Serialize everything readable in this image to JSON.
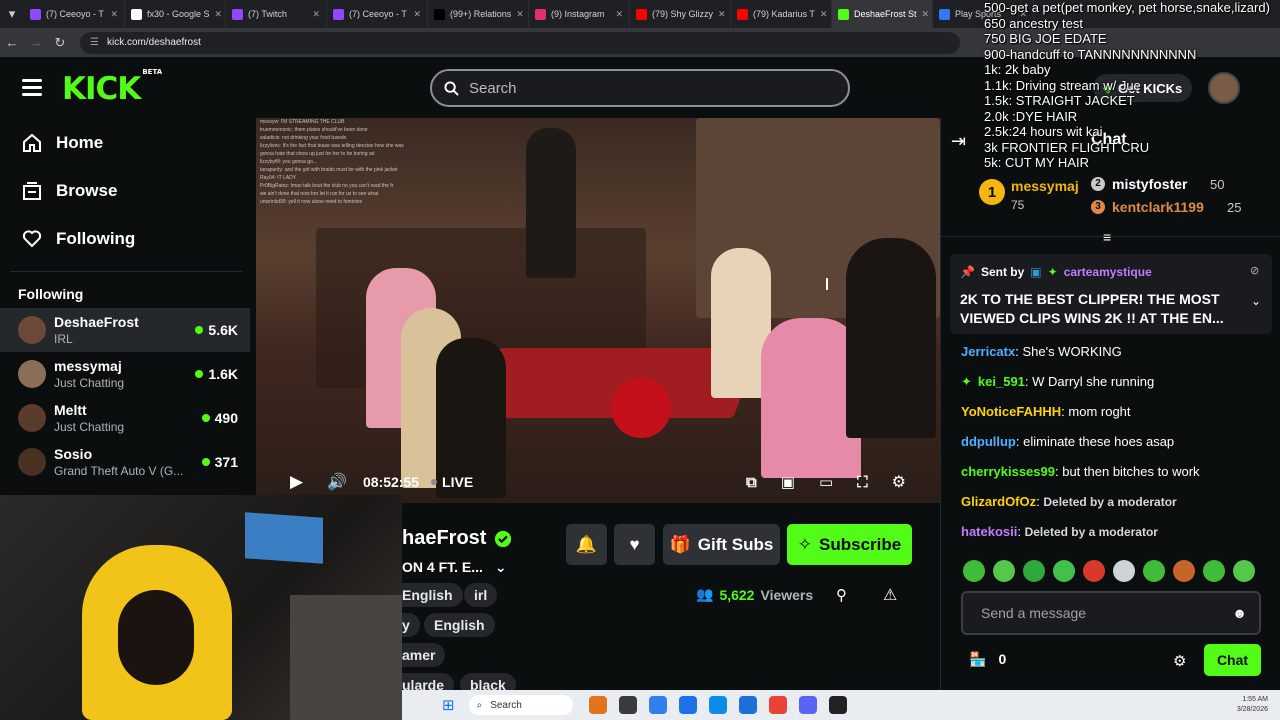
{
  "browser": {
    "tabs": [
      {
        "label": "(7) Ceeoyo - T",
        "color": "#9146ff"
      },
      {
        "label": "fx30 - Google S",
        "color": "#ffffff"
      },
      {
        "label": "(7) Twitch",
        "color": "#9146ff"
      },
      {
        "label": "(7) Ceeoyo - T",
        "color": "#9146ff"
      },
      {
        "label": "(99+) Relations",
        "color": "#000000"
      },
      {
        "label": "(9) Instagram",
        "color": "#e1306c"
      },
      {
        "label": "(79) Shy Glizzy",
        "color": "#ff0000"
      },
      {
        "label": "(79) Kadarius T",
        "color": "#ff0000"
      },
      {
        "label": "DeshaeFrost St",
        "color": "#53fc18"
      },
      {
        "label": "Play Sports",
        "color": "#3478f6"
      }
    ],
    "url": "kick.com/deshaefrost"
  },
  "header": {
    "logo": "KICK",
    "beta": "BETA",
    "search_placeholder": "Search",
    "get_kicks": "Get KICKs"
  },
  "sidebar": {
    "nav": [
      {
        "label": "Home",
        "icon": "home-icon"
      },
      {
        "label": "Browse",
        "icon": "browse-icon"
      },
      {
        "label": "Following",
        "icon": "heart-icon"
      }
    ],
    "following_title": "Following",
    "following": [
      {
        "name": "DeshaeFrost",
        "category": "IRL",
        "viewers": "5.6K",
        "avatar": "#6b4a3a"
      },
      {
        "name": "messymaj",
        "category": "Just Chatting",
        "viewers": "1.6K",
        "avatar": "#8a6e5a"
      },
      {
        "name": "Meltt",
        "category": "Just Chatting",
        "viewers": "490",
        "avatar": "#5a3b2c"
      },
      {
        "name": "Sosio",
        "category": "Grand Theft Auto V (G...",
        "viewers": "371",
        "avatar": "#4a3020"
      }
    ]
  },
  "player": {
    "time": "08:52:55",
    "live": "LIVE",
    "overlay_chat": [
      "messyw: I'M STREAMING THE CLUB",
      "truemnemonic: them plates should've been done",
      "saladicis: not drinking your food tuxedo",
      "lizzylives: It's the fact that tease was telling deezian how she was",
      "gonna hate that show up just for her to be boring ad",
      "lizzybyfill: you gonna go...",
      "tanapurity: and the girl with braids must be with the pink jacket",
      "Ray04: IT LADY",
      "Pr0BigRainz: Imao talk bout the club no you can't read the fr",
      "we ain't done that now bro let it run for us to see what",
      "unwrinkd99: yell it now alone need to feminine"
    ]
  },
  "stream": {
    "name": "haeFrost",
    "title": "ON 4 FT. E...",
    "tags_row1": [
      "English",
      "irl"
    ],
    "tags_row2": [
      "y",
      "English"
    ],
    "tags_row3": [
      "amer"
    ],
    "tags_row4": [
      "ularde",
      "black"
    ],
    "viewers": "5,622",
    "viewers_label": "Viewers",
    "gift_subs": "Gift Subs",
    "subscribe": "Subscribe"
  },
  "chat": {
    "title": "Chat",
    "leaderboard": [
      {
        "rank": "1",
        "name": "messymaj",
        "points": "75"
      },
      {
        "rank": "2",
        "name": "mistyfoster",
        "points": "50"
      },
      {
        "rank": "3",
        "name": "kentclark1199",
        "points": "25"
      }
    ],
    "pinned": {
      "sent_by": "Sent by",
      "user": "carteamystique",
      "text": "2K TO THE BEST CLIPPER! THE MOST VIEWED CLIPS WINS 2K !! AT THE EN..."
    },
    "messages": [
      {
        "user": "Jerricatx",
        "text": "She's WORKING",
        "color": "#4fb0ff"
      },
      {
        "user": "kei_591",
        "text": "W Darryl she running",
        "color": "#53fc18"
      },
      {
        "user": "YoNoticeFAHHH",
        "text": "mom roght",
        "color": "#ffd400"
      },
      {
        "user": "ddpullup",
        "text": "eliminate these hoes asap",
        "color": "#4fb0ff"
      },
      {
        "user": "cherrykisses99",
        "text": "but then bitches to work",
        "color": "#53fc18"
      },
      {
        "user": "GlizardOfOz",
        "text": "Deleted by a moderator",
        "color": "#ffd400"
      },
      {
        "user": "hatekosii",
        "text": "Deleted by a moderator",
        "color": "#c47cff"
      }
    ],
    "input_placeholder": "Send a message",
    "kicks_count": "0",
    "chat_button": "Chat"
  },
  "goal_overlay": [
    "500-get a pet(pet monkey, pet horse,snake,lizard)",
    "650 ancestry test",
    "750 BIG JOE EDATE",
    "900-handcuff to TANNNNNNNNNNN",
    "1k: 2k baby",
    "1.1k: Driving stream w/ Jue",
    "1.5k: STRAIGHT JACKET",
    "2.0k :DYE HAIR",
    "2.5k:24 hours wit kai",
    "3k FRONTIER FLIGHT CRU",
    "5k: CUT MY HAIR"
  ],
  "taskbar": {
    "search": "Search",
    "time": "1:55 AM",
    "date": "3/28/2026"
  }
}
